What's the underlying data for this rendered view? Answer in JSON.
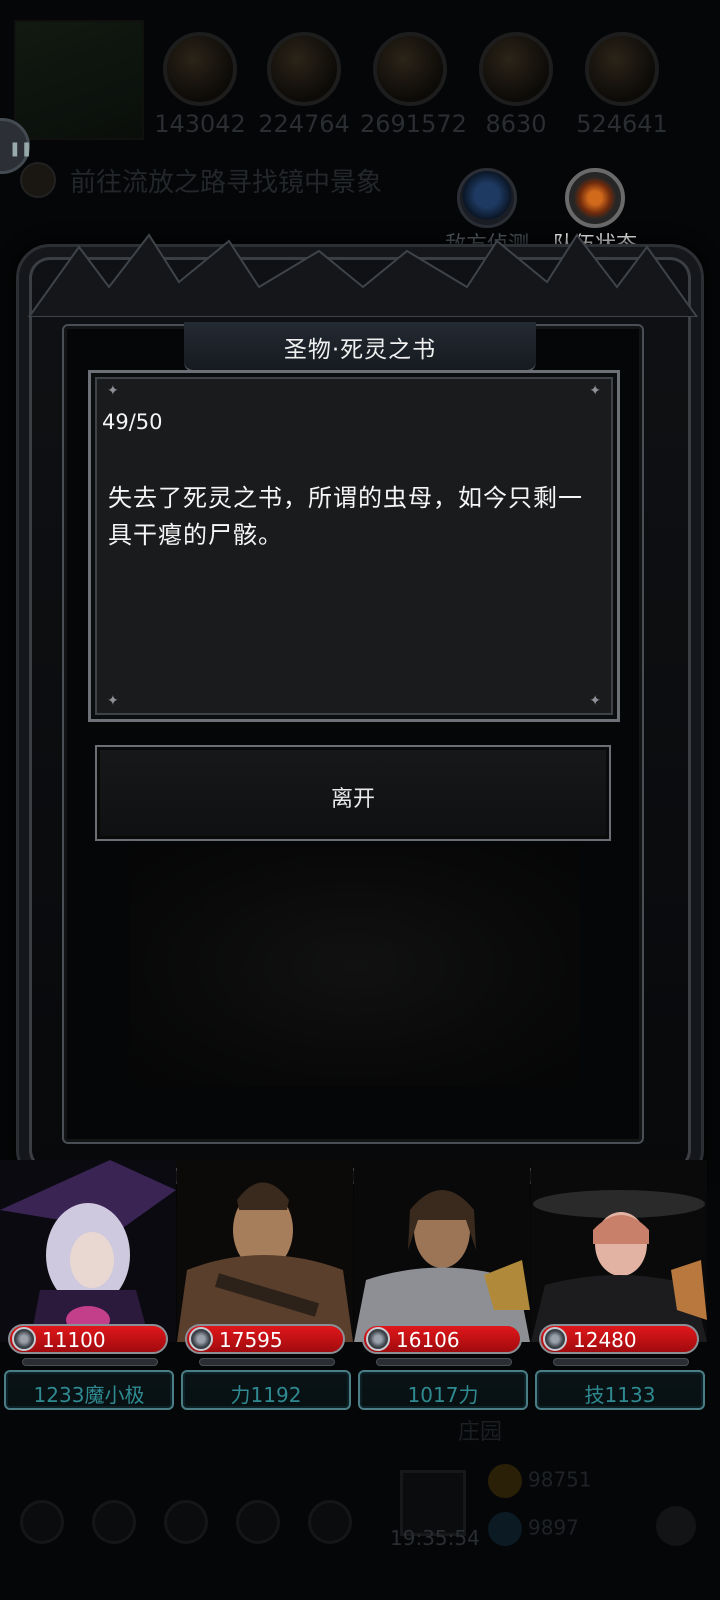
{
  "hud": {
    "resources": [
      {
        "icon": "ore-orb-icon",
        "value": "143042"
      },
      {
        "icon": "wood-orb-icon",
        "value": "224764"
      },
      {
        "icon": "stone-orb-icon",
        "value": "2691572"
      },
      {
        "icon": "crystal-orb-icon",
        "value": "8630"
      },
      {
        "icon": "coal-orb-icon",
        "value": "524641"
      }
    ],
    "quest_text": "前往流放之路寻找镜中景象",
    "enemy_scout_label": "敌方侦测",
    "team_status_label": "队伍状态"
  },
  "dialog": {
    "title": "圣物·死灵之书",
    "progress": "49/50",
    "story": "失去了死灵之书，所谓的虫母，如今只剩一具干瘪的尸骸。",
    "leave_button": "离开"
  },
  "heroes": [
    {
      "name": "witch",
      "hp": "11100",
      "stat": "1233魔小极",
      "palette": [
        "#3a2454",
        "#cfc9e0",
        "#c43f8a"
      ]
    },
    {
      "name": "barbarian",
      "hp": "17595",
      "stat": "力1192",
      "palette": [
        "#5a3f2c",
        "#a77e5c",
        "#2d2219"
      ]
    },
    {
      "name": "knight",
      "hp": "16106",
      "stat": "1017力",
      "palette": [
        "#3a2a1e",
        "#8d8f94",
        "#b08a3a"
      ]
    },
    {
      "name": "rogue",
      "hp": "12480",
      "stat": "技1133",
      "palette": [
        "#2a2a2a",
        "#c9806b",
        "#b9793e"
      ]
    }
  ],
  "bottom": {
    "estate_label": "庄园",
    "clock": "19:35:54",
    "currency_1": "98751",
    "currency_2": "9897"
  },
  "colors": {
    "hp_red": "#d3141a",
    "stat_teal": "#2f8a92",
    "frame_silver": "#6d7076"
  }
}
